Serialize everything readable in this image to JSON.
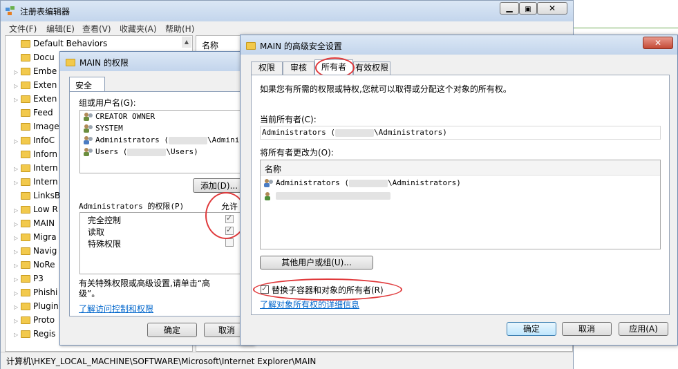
{
  "regedit": {
    "title": "注册表编辑器",
    "menu": [
      "文件(F)",
      "编辑(E)",
      "查看(V)",
      "收藏夹(A)",
      "帮助(H)"
    ],
    "tree_items": [
      {
        "label": "Default Behaviors",
        "expander": false
      },
      {
        "label": "Docu",
        "expander": false
      },
      {
        "label": "Embe",
        "expander": true
      },
      {
        "label": "Exten",
        "expander": true
      },
      {
        "label": "Exten",
        "expander": true
      },
      {
        "label": "Feed",
        "expander": false
      },
      {
        "label": "Image",
        "expander": false
      },
      {
        "label": "InfoC",
        "expander": true
      },
      {
        "label": "Inforn",
        "expander": false
      },
      {
        "label": "Intern",
        "expander": true
      },
      {
        "label": "Intern",
        "expander": true
      },
      {
        "label": "LinksB",
        "expander": false
      },
      {
        "label": "Low R",
        "expander": true
      },
      {
        "label": "MAIN",
        "expander": true
      },
      {
        "label": "Migra",
        "expander": true
      },
      {
        "label": "Navig",
        "expander": true
      },
      {
        "label": "NoRe",
        "expander": true
      },
      {
        "label": "P3",
        "expander": true
      },
      {
        "label": "Phishi",
        "expander": true
      },
      {
        "label": "Plugin",
        "expander": true
      },
      {
        "label": "Proto",
        "expander": true
      },
      {
        "label": "Regis",
        "expander": true
      }
    ],
    "column_name": "名称",
    "status_path": "计算机\\HKEY_LOCAL_MACHINE\\SOFTWARE\\Microsoft\\Internet Explorer\\MAIN"
  },
  "perm_dialog": {
    "title": "MAIN 的权限",
    "tab": "安全",
    "group_label": "组或用户名(G):",
    "users": [
      "CREATOR OWNER",
      "SYSTEM",
      "Administrators (",
      "Users ("
    ],
    "admin_suffix": "\\Administ",
    "users_suffix": "\\Users)",
    "add_button": "添加(D)...",
    "perm_label": "Administrators 的权限(P)",
    "allow_label": "允许",
    "permissions": [
      {
        "label": "完全控制",
        "allow": true
      },
      {
        "label": "读取",
        "allow": true
      },
      {
        "label": "特殊权限",
        "allow": false
      }
    ],
    "advanced_hint": "有关特殊权限或高级设置,请单击“高级”。",
    "link": "了解访问控制和权限",
    "ok": "确定",
    "cancel": "取消"
  },
  "adv_dialog": {
    "title": "MAIN 的高级安全设置",
    "tabs": [
      "权限",
      "审核",
      "所有者",
      "有效权限"
    ],
    "intro": "如果您有所需的权限或特权,您就可以取得或分配这个对象的所有权。",
    "current_owner_label": "当前所有者(C):",
    "current_owner_value": "Administrators (",
    "current_owner_suffix": "\\Administrators)",
    "change_to_label": "将所有者更改为(O):",
    "list_header": "名称",
    "list_items": [
      "Administrators (",
      ""
    ],
    "list_item_suffix": "\\Administrators)",
    "other_users_button": "其他用户或组(U)...",
    "replace_checkbox": "替换子容器和对象的所有者(R)",
    "replace_checked": true,
    "learn_link": "了解对象所有权的详细信息",
    "ok": "确定",
    "cancel": "取消",
    "apply": "应用(A)"
  }
}
